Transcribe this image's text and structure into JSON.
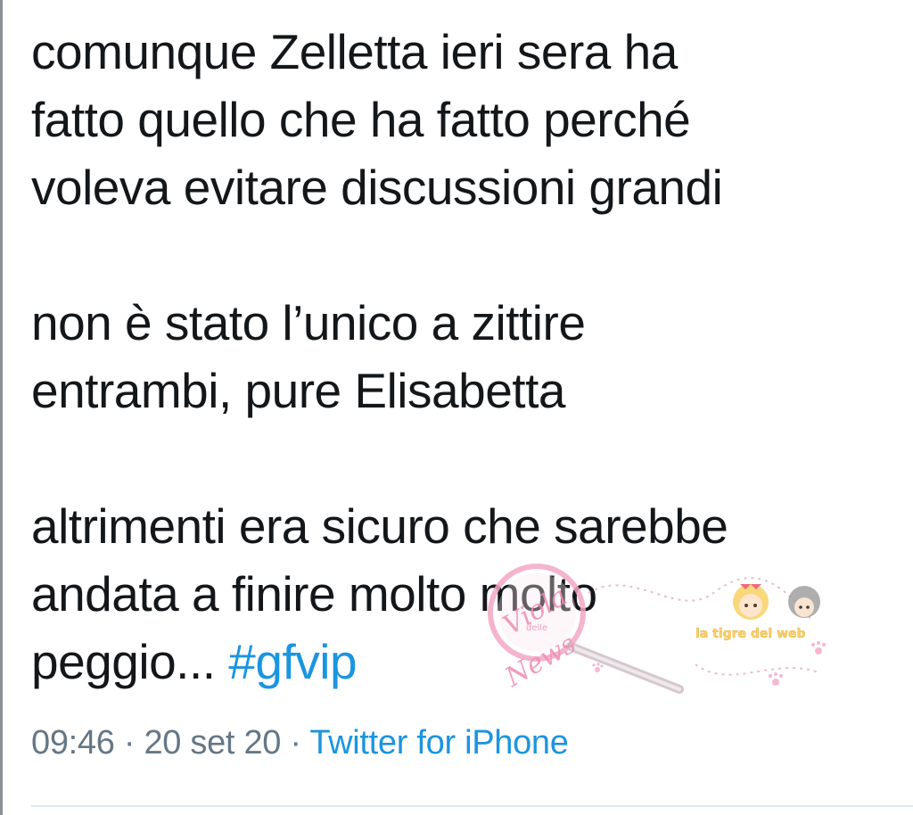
{
  "tweet": {
    "paragraph1": [
      "comunque Zelletta ieri sera ha",
      "fatto quello che ha fatto perché",
      "voleva evitare discussioni grandi"
    ],
    "paragraph2": [
      "non è stato l’unico a zittire",
      "entrambi, pure Elisabetta"
    ],
    "paragraph3": [
      "altrimenti era sicuro che sarebbe",
      "andata a finire molto molto",
      "peggio... "
    ],
    "hashtag": "#gfvip"
  },
  "meta": {
    "time": "09:46",
    "separator1": " · ",
    "date": "20 set 20",
    "separator2": " · ",
    "source": "Twitter for iPhone"
  },
  "watermark": {
    "text_main": "Viola",
    "text_small": "delle",
    "text_news": "News",
    "text_banner": "la tigre del web",
    "accent_color": "#f3a7c4",
    "banner_color": "#f7c948"
  },
  "colors": {
    "text": "#14171a",
    "link": "#1b95e0",
    "meta": "#657786",
    "divider": "#e1e8ed"
  }
}
